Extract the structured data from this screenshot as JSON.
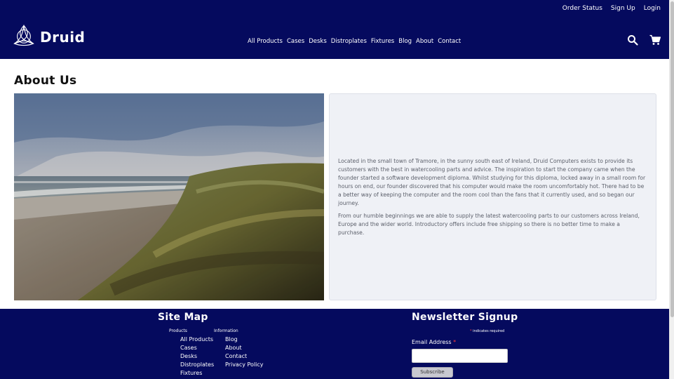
{
  "topbar": {
    "order_status": "Order Status",
    "sign_up": "Sign Up",
    "login": "Login"
  },
  "brand": {
    "name": "Druid"
  },
  "nav": [
    "All Products",
    "Cases",
    "Desks",
    "Distroplates",
    "Fixtures",
    "Blog",
    "About",
    "Contact"
  ],
  "icons": {
    "search": "search-icon",
    "cart": "cart-icon",
    "logo": "celtic-triquetra-logo"
  },
  "main": {
    "title": "About Us",
    "paragraphs": [
      "Located in the small town of Tramore, in the sunny south east of Ireland, Druid Computers exists to provide its customers with the best in watercooling parts and advice. The inspiration to start the company came when the founder started a software development diploma. Whilst studying for this diploma, locked away in a small room for hours on end, our founder discovered that his computer would make the room uncomfortably hot. There had to be a better way of keeping the computer and the room cool than the fans that it currently used, and so began our journey.",
      "From our humble beginnings we are able to supply the latest watercooling parts to our customers across Ireland, Europe and the wider world. Introductory offers include free shipping so there is no better time to make a purchase."
    ]
  },
  "footer": {
    "sitemap_title": "Site Map",
    "products_heading": "Products",
    "products": [
      "All Products",
      "Cases",
      "Desks",
      "Distroplates",
      "Fixtures"
    ],
    "information_heading": "Information",
    "information": [
      "Blog",
      "About",
      "Contact",
      "Privacy Policy"
    ],
    "newsletter_title": "Newsletter Signup",
    "required_star": "*",
    "required_note": "indicates required",
    "email_label": "Email Address",
    "email_value": "",
    "subscribe_label": "Subscribe"
  },
  "colors": {
    "brand_navy": "#050a5e",
    "card_bg": "#eff1f6",
    "required": "#ff3b3b"
  }
}
